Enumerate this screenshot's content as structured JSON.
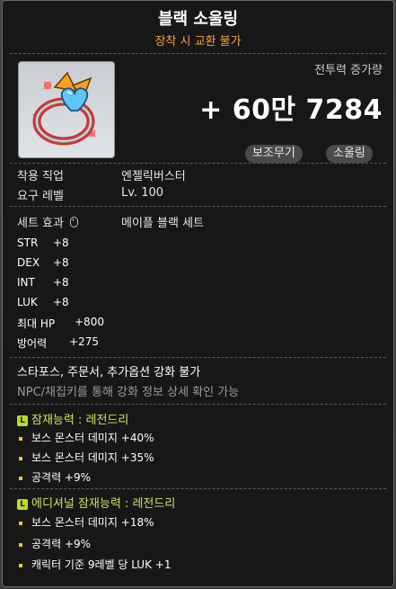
{
  "item": {
    "name": "블랙 소울링",
    "trade_notice": "장착 시 교환 불가",
    "combat_power_label": "전투력 증가량",
    "combat_power_value": "+ 60만 7284",
    "tags": [
      "보조무기",
      "소울링"
    ]
  },
  "requirements": {
    "job_label": "착용 직업",
    "job_value": "엔젤릭버스터",
    "level_label": "요구 레벨",
    "level_value": "Lv. 100"
  },
  "set_effect": {
    "label": "세트 효과",
    "value": "메이플 블랙 세트"
  },
  "stats": [
    {
      "name": "STR",
      "value": "+8"
    },
    {
      "name": "DEX",
      "value": "+8"
    },
    {
      "name": "INT",
      "value": "+8"
    },
    {
      "name": "LUK",
      "value": "+8"
    },
    {
      "name": "최대 HP",
      "value": "+800"
    },
    {
      "name": "방어력",
      "value": "+275"
    }
  ],
  "notices": {
    "enhance_blocked": "스타포스, 주문서, 추가옵션 강화 불가",
    "npc_hint": "NPC/채집키를 통해 강화 정보 상세 확인 가능"
  },
  "potential": {
    "badge": "L",
    "title": "잠재능력 : 레전드리",
    "lines": [
      "보스 몬스터 데미지 +40%",
      "보스 몬스터 데미지 +35%",
      "공격력 +9%"
    ]
  },
  "additional_potential": {
    "badge": "L",
    "title": "에디셔널 잠재능력 : 레전드리",
    "lines": [
      "보스 몬스터 데미지 +18%",
      "공격력 +9%",
      "캐릭터 기준 9레벨 당 LUK +1"
    ]
  },
  "colors": {
    "title": "#ffffff",
    "trade_notice": "#f7a23a",
    "potential": "#c8e85a",
    "bullet": "#f3c531"
  }
}
